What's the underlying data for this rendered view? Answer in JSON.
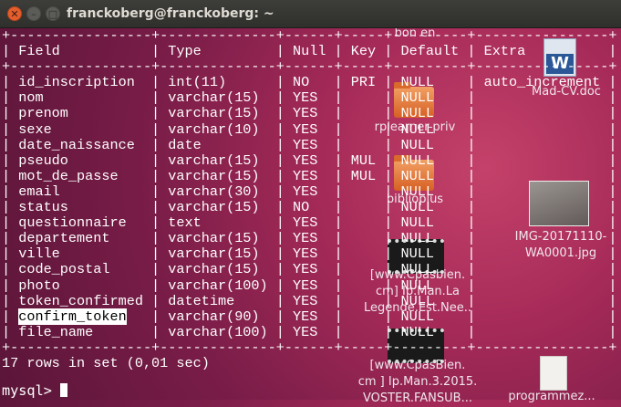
{
  "window": {
    "title": "franckoberg@franckoberg: ~",
    "buttons": [
      "close",
      "minimize",
      "maximize"
    ]
  },
  "desktop_icons": [
    {
      "name": "mad-cv-doc",
      "label": "Mad-CV.doc",
      "icon": "word-document-icon"
    },
    {
      "name": "rplearner-priv",
      "label": "rplearner-priv",
      "icon": "folder-icon"
    },
    {
      "name": "biblioplus",
      "label": "biblioplus",
      "icon": "folder-icon"
    },
    {
      "name": "img-jpg",
      "label_lines": [
        "IMG-20171110-",
        "WA0001.jpg"
      ],
      "icon": "image-icon"
    },
    {
      "name": "video-man-la-legende",
      "label_lines": [
        "[www.Cpasbien.",
        "cm] Ip.Man.La",
        "Legende.Est.Nee.."
      ],
      "icon": "video-icon"
    },
    {
      "name": "video-ip-man-3",
      "label_lines": [
        "[www.CpasBien.",
        "cm ] Ip.Man.3.2015.",
        "VOSTER.FANSUB..."
      ],
      "icon": "video-icon"
    },
    {
      "name": "programmez-doc",
      "label": "programmez...",
      "icon": "text-document-icon"
    },
    {
      "name": "bon-en",
      "label": "bon en",
      "icon": "none"
    }
  ],
  "terminal": {
    "columns": [
      "Field",
      "Type",
      "Null",
      "Key",
      "Default",
      "Extra"
    ],
    "rows": [
      [
        "id_inscription",
        "int(11)",
        "NO",
        "PRI",
        "NULL",
        "auto_increment"
      ],
      [
        "nom",
        "varchar(15)",
        "YES",
        "",
        "NULL",
        ""
      ],
      [
        "prenom",
        "varchar(15)",
        "YES",
        "",
        "NULL",
        ""
      ],
      [
        "sexe",
        "varchar(10)",
        "YES",
        "",
        "NULL",
        ""
      ],
      [
        "date_naissance",
        "date",
        "YES",
        "",
        "NULL",
        ""
      ],
      [
        "pseudo",
        "varchar(15)",
        "YES",
        "MUL",
        "NULL",
        ""
      ],
      [
        "mot_de_passe",
        "varchar(15)",
        "YES",
        "MUL",
        "NULL",
        ""
      ],
      [
        "email",
        "varchar(30)",
        "YES",
        "",
        "NULL",
        ""
      ],
      [
        "status",
        "varchar(15)",
        "NO",
        "",
        "NULL",
        ""
      ],
      [
        "questionnaire",
        "text",
        "YES",
        "",
        "NULL",
        ""
      ],
      [
        "departement",
        "varchar(15)",
        "YES",
        "",
        "NULL",
        ""
      ],
      [
        "ville",
        "varchar(15)",
        "YES",
        "",
        "NULL",
        ""
      ],
      [
        "code_postal",
        "varchar(15)",
        "YES",
        "",
        "NULL",
        ""
      ],
      [
        "photo",
        "varchar(100)",
        "YES",
        "",
        "NULL",
        ""
      ],
      [
        "token_confirmed",
        "datetime",
        "YES",
        "",
        "NULL",
        ""
      ],
      [
        "confirm_token",
        "varchar(90)",
        "YES",
        "",
        "NULL",
        ""
      ],
      [
        "file_name",
        "varchar(100)",
        "YES",
        "",
        "NULL",
        ""
      ]
    ],
    "highlighted_field": "confirm_token",
    "summary": "17 rows in set (0,01 sec)",
    "prompt": "mysql> "
  }
}
